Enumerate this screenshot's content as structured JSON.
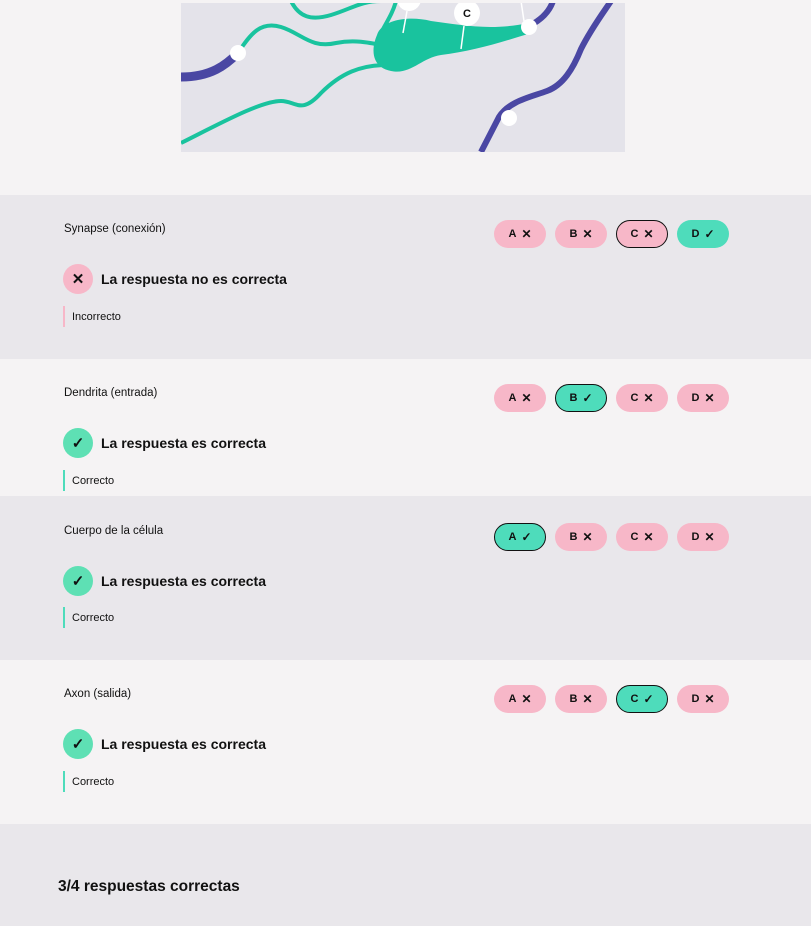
{
  "progress": {
    "fraction": 0.32
  },
  "figure": {
    "labels": [
      "C"
    ],
    "colors": {
      "background": "#e4e3ea",
      "cell": "#19c39e",
      "axon": "#4a47a3"
    }
  },
  "questions": [
    {
      "title": "Synapse (conexión)",
      "options": [
        {
          "letter": "A",
          "mark": "✕"
        },
        {
          "letter": "B",
          "mark": "✕"
        },
        {
          "letter": "C",
          "mark": "✕"
        },
        {
          "letter": "D",
          "mark": "✓"
        }
      ],
      "feedback": "La respuesta no es correcta",
      "feedback_icon": "✕",
      "note": "Incorrecto"
    },
    {
      "title": "Dendrita (entrada)",
      "options": [
        {
          "letter": "A",
          "mark": "✕"
        },
        {
          "letter": "B",
          "mark": "✓"
        },
        {
          "letter": "C",
          "mark": "✕"
        },
        {
          "letter": "D",
          "mark": "✕"
        }
      ],
      "feedback": "La respuesta es correcta",
      "feedback_icon": "✓",
      "note": "Correcto"
    },
    {
      "title": "Cuerpo de la célula",
      "options": [
        {
          "letter": "A",
          "mark": "✓"
        },
        {
          "letter": "B",
          "mark": "✕"
        },
        {
          "letter": "C",
          "mark": "✕"
        },
        {
          "letter": "D",
          "mark": "✕"
        }
      ],
      "feedback": "La respuesta es correcta",
      "feedback_icon": "✓",
      "note": "Correcto"
    },
    {
      "title": "Axon (salida)",
      "options": [
        {
          "letter": "A",
          "mark": "✕"
        },
        {
          "letter": "B",
          "mark": "✕"
        },
        {
          "letter": "C",
          "mark": "✓"
        },
        {
          "letter": "D",
          "mark": "✕"
        }
      ],
      "feedback": "La respuesta es correcta",
      "feedback_icon": "✓",
      "note": "Correcto"
    }
  ],
  "summary": "3/4 respuestas correctas",
  "colors": {
    "correct": "#4edcbb",
    "incorrect": "#f7b7c8",
    "progress": "#19c39e"
  }
}
